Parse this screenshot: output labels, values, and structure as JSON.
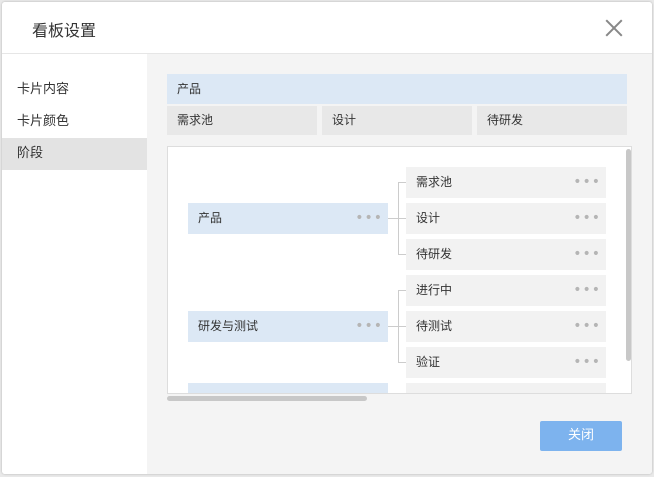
{
  "dialog": {
    "title": "看板设置",
    "close_label": "关闭"
  },
  "sidebar": {
    "items": [
      {
        "label": "卡片内容"
      },
      {
        "label": "卡片颜色"
      },
      {
        "label": "阶段",
        "active": true
      }
    ]
  },
  "product_header": {
    "group": "产品",
    "stages": [
      "需求池",
      "设计",
      "待研发"
    ]
  },
  "tree": {
    "groups": [
      {
        "label": "产品",
        "stages": [
          "需求池",
          "设计",
          "待研发"
        ]
      },
      {
        "label": "研发与测试",
        "stages": [
          "进行中",
          "待测试",
          "验证"
        ]
      },
      {
        "label": "",
        "stages": [
          ""
        ]
      }
    ],
    "more_icon": "ellipsis-icon"
  },
  "colors": {
    "group_bg": "#dce8f5",
    "stage_bg": "#f2f2f2",
    "active_sidebar": "#e3e3e3",
    "primary_button": "#7db3ee"
  }
}
